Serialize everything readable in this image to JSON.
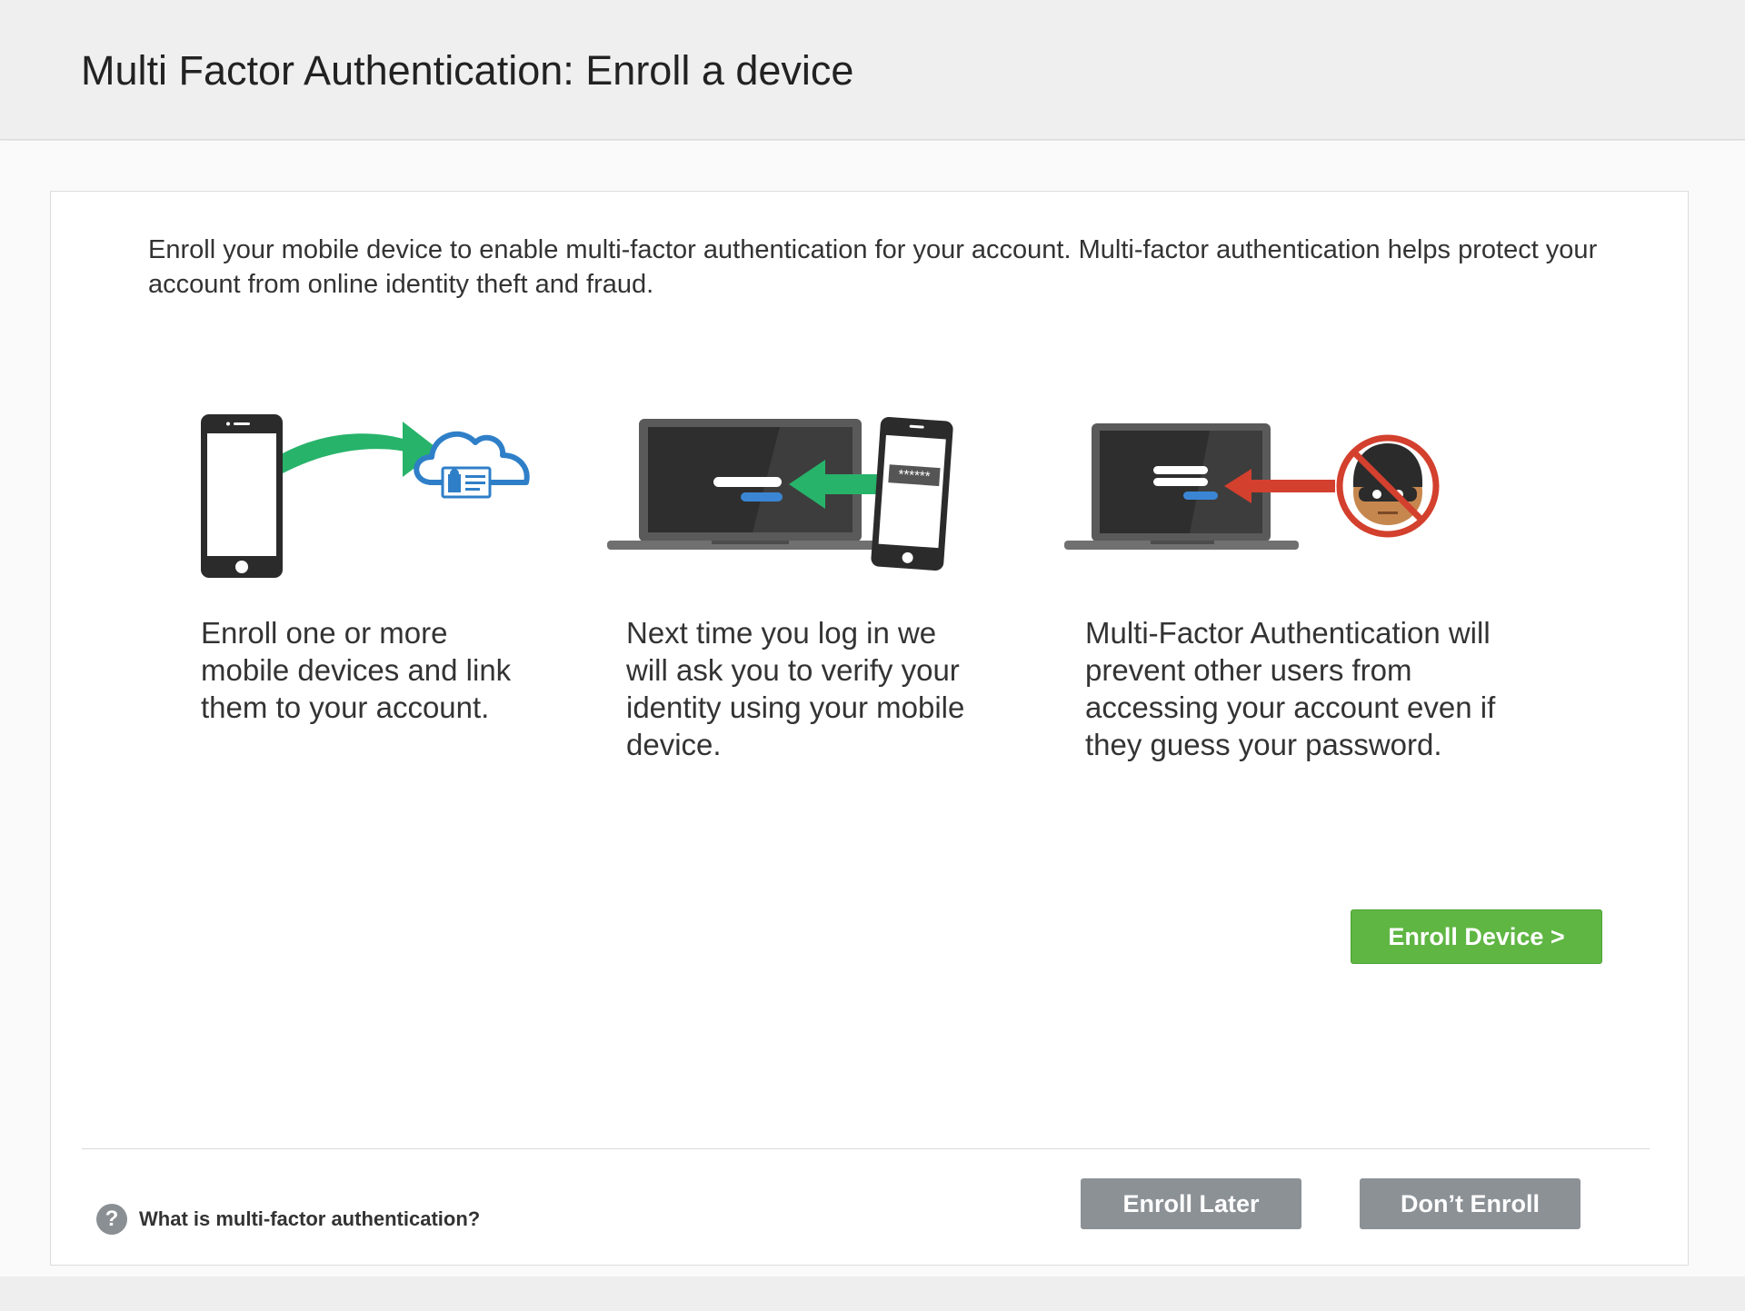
{
  "header": {
    "title": "Multi Factor Authentication: Enroll a device"
  },
  "intro": {
    "text": "Enroll your mobile device to enable multi-factor authentication for your account.  Multi-factor authentication helps protect your account from online identity theft and fraud."
  },
  "steps": [
    {
      "icon": "phone-to-cloud-icon",
      "caption": "Enroll one or more mobile devices and link them to your account."
    },
    {
      "icon": "phone-to-laptop-icon",
      "caption": "Next time you log in we will ask you to verify your identity using your mobile device."
    },
    {
      "icon": "blocked-intruder-icon",
      "caption": "Multi-Factor Authentication will prevent other users from accessing your account even if they guess your password."
    }
  ],
  "password_mask": "******",
  "buttons": {
    "enroll_device": "Enroll Device  >",
    "enroll_later": "Enroll Later",
    "dont_enroll": "Don’t Enroll"
  },
  "help": {
    "icon_glyph": "?",
    "text": "What is multi-factor authentication?"
  },
  "colors": {
    "accent_green": "#5fb643",
    "arrow_green": "#27b36a",
    "cloud_blue": "#2f7fc8",
    "block_red": "#d3402e",
    "button_gray": "#8c9196"
  }
}
